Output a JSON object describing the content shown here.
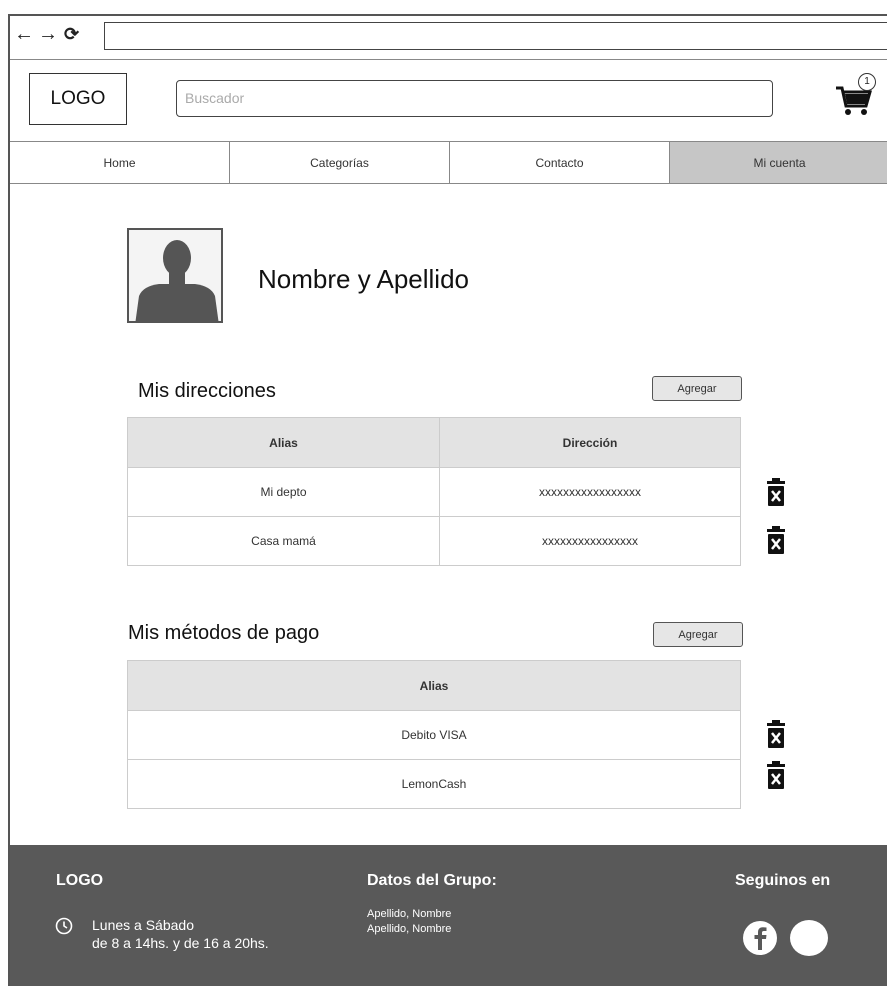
{
  "browser": {
    "back": "←",
    "forward": "→",
    "reload": "⟳"
  },
  "header": {
    "logo": "LOGO",
    "search_placeholder": "Buscador",
    "cart_count": "1"
  },
  "nav": {
    "items": [
      "Home",
      "Categorías",
      "Contacto",
      "Mi cuenta"
    ]
  },
  "profile": {
    "name": "Nombre y Apellido"
  },
  "addresses": {
    "title": "Mis direcciones",
    "add_label": "Agregar",
    "columns": [
      "Alias",
      "Dirección"
    ],
    "rows": [
      {
        "alias": "Mi depto",
        "address": "xxxxxxxxxxxxxxxxx"
      },
      {
        "alias": "Casa mamá",
        "address": "xxxxxxxxxxxxxxxx"
      }
    ]
  },
  "payments": {
    "title": "Mis métodos de pago",
    "add_label": "Agregar",
    "columns": [
      "Alias"
    ],
    "rows": [
      {
        "alias": "Debito VISA"
      },
      {
        "alias": "LemonCash"
      }
    ]
  },
  "footer": {
    "logo": "LOGO",
    "hours_line1": "Lunes a Sábado",
    "hours_line2": "de 8 a 14hs. y de 16 a 20hs.",
    "group_title": "Datos del Grupo:",
    "members": [
      "Apellido, Nombre",
      "Apellido, Nombre"
    ],
    "follow_title": "Seguinos en"
  }
}
